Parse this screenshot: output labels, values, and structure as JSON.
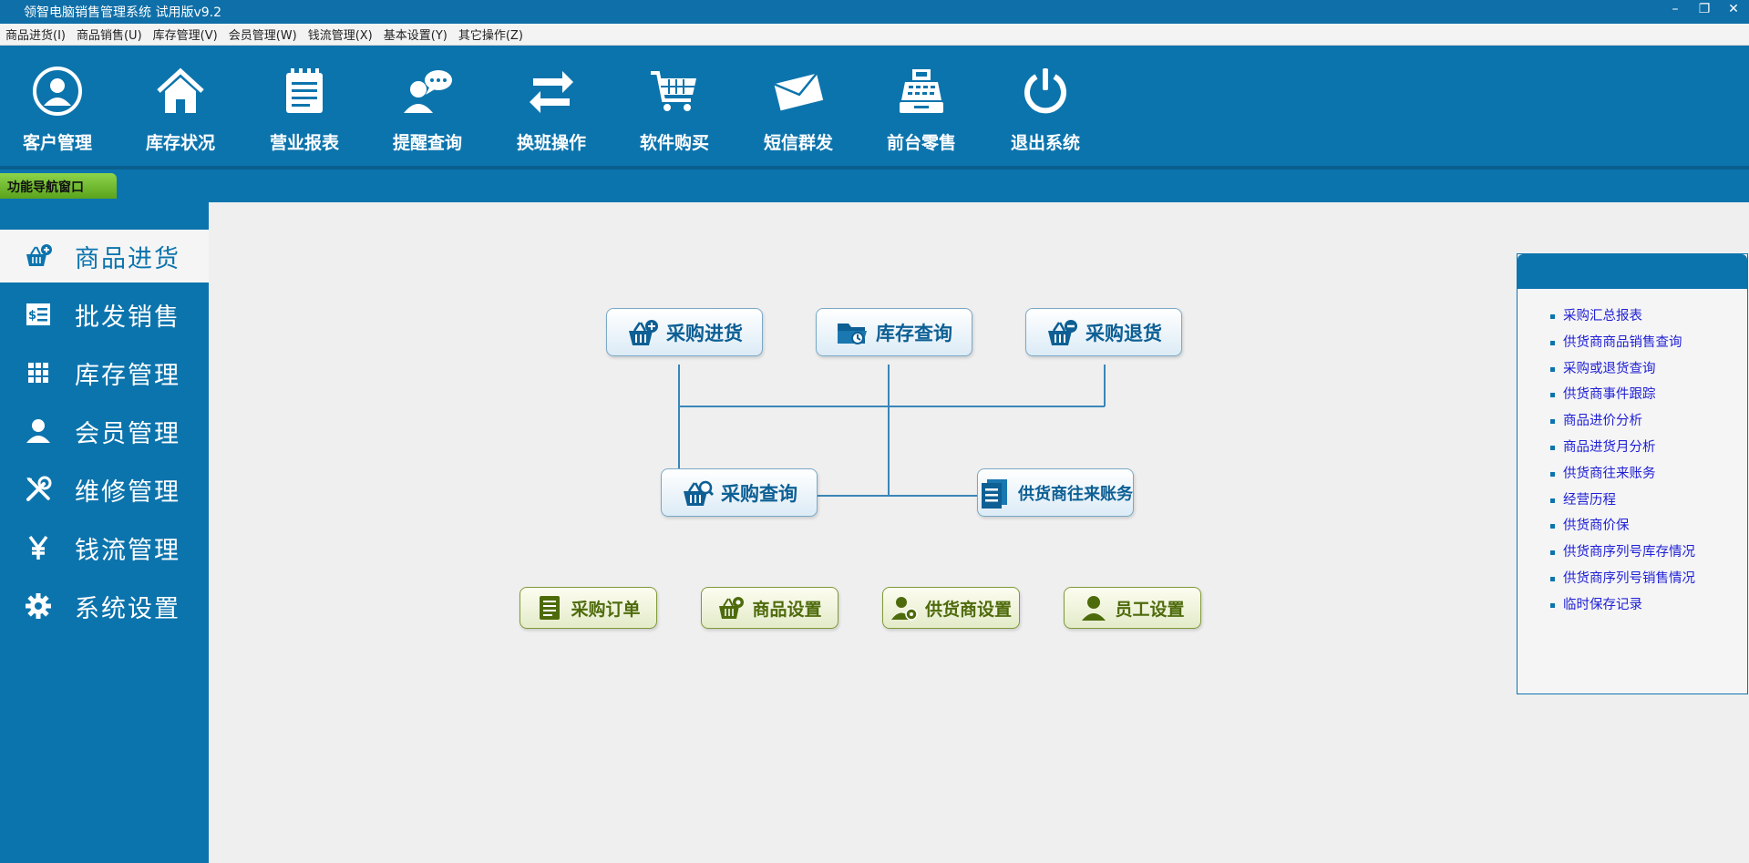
{
  "window": {
    "title": "领智电脑销售管理系统 试用版v9.2",
    "min": "–",
    "restore": "❐",
    "close": "✕"
  },
  "menu": [
    "商品进货(I)",
    "商品销售(U)",
    "库存管理(V)",
    "会员管理(W)",
    "钱流管理(X)",
    "基本设置(Y)",
    "其它操作(Z)"
  ],
  "toolbar": [
    {
      "label": "客户管理",
      "icon": "customer-icon"
    },
    {
      "label": "库存状况",
      "icon": "house-icon"
    },
    {
      "label": "营业报表",
      "icon": "notepad-icon"
    },
    {
      "label": "提醒查询",
      "icon": "chat-person-icon"
    },
    {
      "label": "换班操作",
      "icon": "swap-arrows-icon"
    },
    {
      "label": "软件购买",
      "icon": "cart-icon"
    },
    {
      "label": "短信群发",
      "icon": "envelope-icon"
    },
    {
      "label": "前台零售",
      "icon": "cash-register-icon"
    },
    {
      "label": "退出系统",
      "icon": "power-icon"
    }
  ],
  "nav_tab": "功能导航窗口",
  "sidebar": [
    {
      "label": "商品进货",
      "icon": "basket-plus-icon",
      "active": true
    },
    {
      "label": "批发销售",
      "icon": "invoice-icon"
    },
    {
      "label": "库存管理",
      "icon": "grid-icon"
    },
    {
      "label": "会员管理",
      "icon": "person-icon"
    },
    {
      "label": "维修管理",
      "icon": "tools-icon"
    },
    {
      "label": "钱流管理",
      "icon": "yen-icon"
    },
    {
      "label": "系统设置",
      "icon": "gear-icon"
    }
  ],
  "flow": {
    "purchase_in": "采购进货",
    "stock_query": "库存查询",
    "purchase_return": "采购退货",
    "purchase_query": "采购查询",
    "supplier_accounts": "供货商往来账务",
    "purchase_order": "采购订单",
    "goods_setting": "商品设置",
    "supplier_setting": "供货商设置",
    "staff_setting": "员工设置"
  },
  "links": [
    "采购汇总报表",
    "供货商商品销售查询",
    "采购或退货查询",
    "供货商事件跟踪",
    "商品进价分析",
    "商品进货月分析",
    "供货商往来账务",
    "经营历程",
    "供货商价保",
    "供货商序列号库存情况",
    "供货商序列号销售情况",
    "临时保存记录"
  ],
  "colors": {
    "primary": "#0c74ad",
    "green_tab": "#6ab82a",
    "link": "#1f1fd6"
  }
}
